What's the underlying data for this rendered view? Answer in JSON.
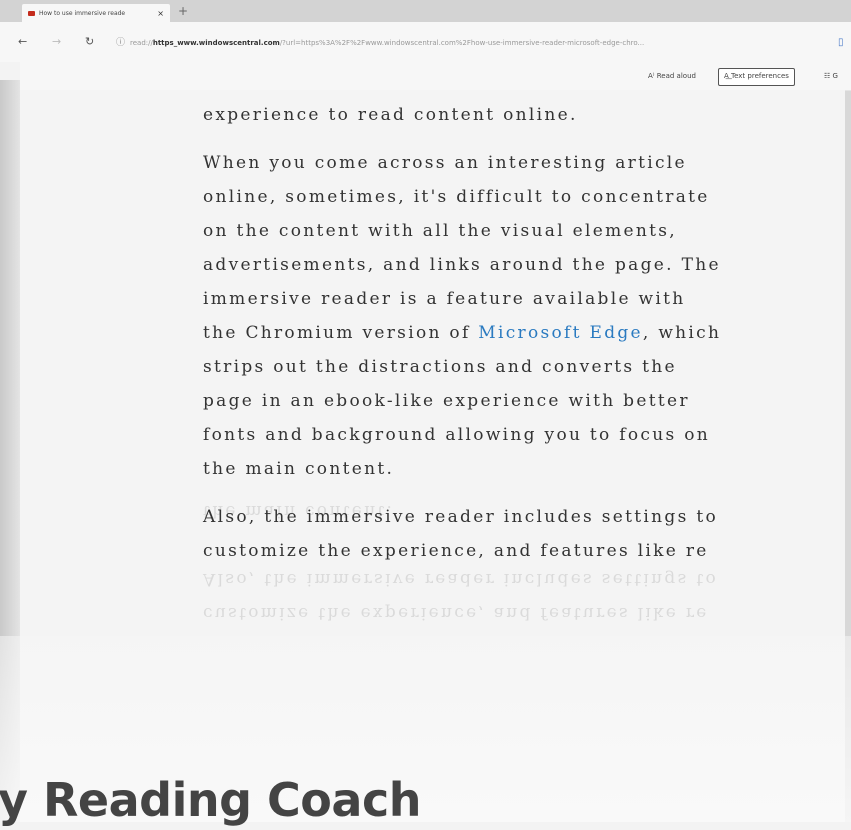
{
  "browser": {
    "tab_title": "How to use immersive reade",
    "new_tab": "+",
    "nav": {
      "back": "←",
      "forward": "→",
      "refresh": "↻"
    },
    "url_prefix": "read://",
    "url_host": "https_www.windowscentral.com",
    "url_rest": "/?url=https%3A%2F%2Fwww.windowscentral.com%2Fhow-use-immersive-reader-microsoft-edge-chro..."
  },
  "reader_toolbar": {
    "read_aloud": "Read aloud",
    "text_preferences": "Text preferences",
    "grammar_tools": "G"
  },
  "article": {
    "p1": [
      "experience to read content online."
    ],
    "p2": [
      "When you come across an interesting article",
      "online, sometimes, it's difficult to concentrate",
      "on the content with all the visual elements,",
      "advertisements, and links around the page. The",
      "immersive reader is a feature available with"
    ],
    "p2_line6_before": "the Chromium version of ",
    "p2_link": "Microsoft Edge",
    "p2_line6_after": ", which",
    "p2_rest": [
      "strips out the distractions and converts the",
      "page in an ebook-like experience with better",
      "fonts and background allowing you to focus on",
      "the main content."
    ],
    "p3": [
      "Also, the immersive reader includes settings to",
      "customize the experience, and features like re"
    ]
  },
  "overlay_title": "y Reading Coach",
  "colors": {
    "link": "#2a7ac0",
    "text": "#333333",
    "title": "#444444"
  }
}
